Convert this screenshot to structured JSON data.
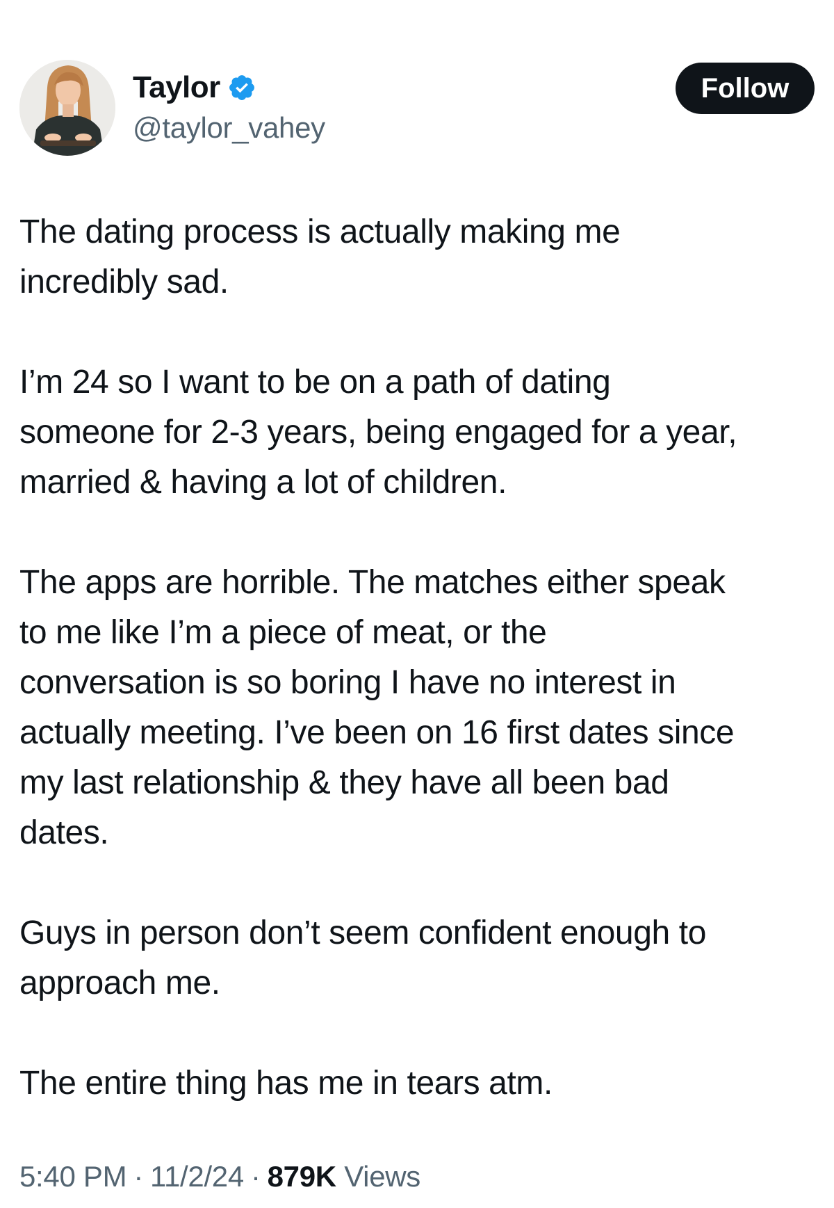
{
  "author": {
    "display_name": "Taylor",
    "handle": "@taylor_vahey",
    "verified": true,
    "avatar_icon": "profile-photo"
  },
  "follow_button": {
    "label": "Follow"
  },
  "tweet": {
    "paragraphs": [
      "The dating process is actually making me\nincredibly sad.",
      "I’m 24 so I want to be on a path of dating\nsomeone for 2-3 years, being engaged for a year,\nmarried & having a lot of children.",
      "The apps are horrible. The matches either speak\nto me like I’m a piece of meat, or the\nconversation is so boring I have no interest in\nactually meeting. I’ve been on 16 first dates since\nmy last relationship & they have all been bad\ndates.",
      "Guys in person don’t seem confident enough to\napproach me.",
      "The entire thing has me in tears atm."
    ]
  },
  "meta": {
    "time": "5:40 PM",
    "date": "11/2/24",
    "separator": "·",
    "views_count": "879K",
    "views_label": "Views"
  },
  "colors": {
    "text_primary": "#0f1419",
    "text_secondary": "#536471",
    "verified_blue": "#1d9bf0",
    "follow_bg": "#0f1419",
    "follow_text": "#ffffff"
  }
}
